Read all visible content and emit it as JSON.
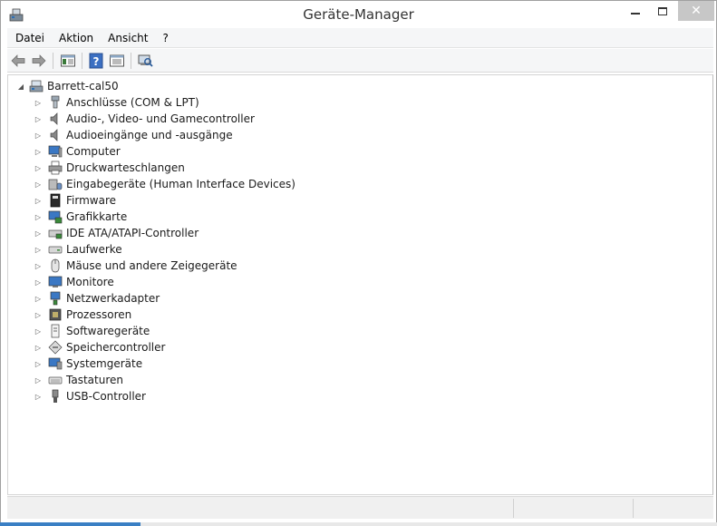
{
  "window": {
    "title": "Geräte-Manager",
    "close_glyph": "✕"
  },
  "menu": [
    {
      "label": "Datei"
    },
    {
      "label": "Aktion"
    },
    {
      "label": "Ansicht"
    },
    {
      "label": "?"
    }
  ],
  "toolbar": {
    "icons": [
      "back-arrow-icon",
      "forward-arrow-icon",
      "show-hide-console-tree-icon",
      "help-icon",
      "properties-icon",
      "scan-hardware-icon"
    ]
  },
  "tree": {
    "root": {
      "label": "Barrett-cal50",
      "expanded": true,
      "expander": "◢"
    },
    "collapsed_glyph": "▷",
    "items": [
      {
        "label": "Anschlüsse (COM & LPT)",
        "icon": "port-icon"
      },
      {
        "label": "Audio-, Video- und Gamecontroller",
        "icon": "speaker-icon"
      },
      {
        "label": "Audioeingänge und -ausgänge",
        "icon": "speaker-icon"
      },
      {
        "label": "Computer",
        "icon": "computer-icon"
      },
      {
        "label": "Druckwarteschlangen",
        "icon": "printer-icon"
      },
      {
        "label": "Eingabegeräte (Human Interface Devices)",
        "icon": "hid-icon"
      },
      {
        "label": "Firmware",
        "icon": "firmware-icon"
      },
      {
        "label": "Grafikkarte",
        "icon": "display-adapter-icon"
      },
      {
        "label": "IDE ATA/ATAPI-Controller",
        "icon": "ide-controller-icon"
      },
      {
        "label": "Laufwerke",
        "icon": "disk-drive-icon"
      },
      {
        "label": "Mäuse und andere Zeigegeräte",
        "icon": "mouse-icon"
      },
      {
        "label": "Monitore",
        "icon": "monitor-icon"
      },
      {
        "label": "Netzwerkadapter",
        "icon": "network-adapter-icon"
      },
      {
        "label": "Prozessoren",
        "icon": "processor-icon"
      },
      {
        "label": "Softwaregeräte",
        "icon": "software-device-icon"
      },
      {
        "label": "Speichercontroller",
        "icon": "storage-controller-icon"
      },
      {
        "label": "Systemgeräte",
        "icon": "system-device-icon"
      },
      {
        "label": "Tastaturen",
        "icon": "keyboard-icon"
      },
      {
        "label": "USB-Controller",
        "icon": "usb-icon"
      }
    ]
  }
}
